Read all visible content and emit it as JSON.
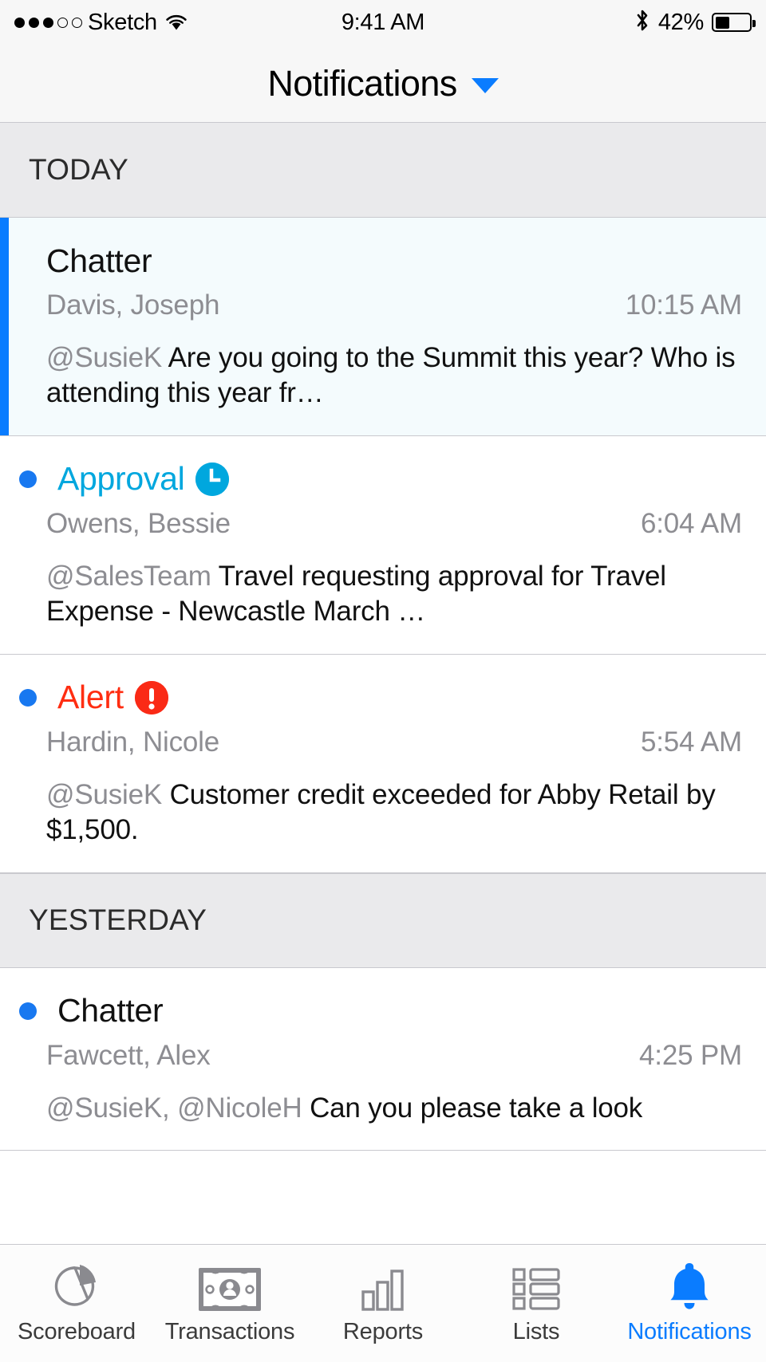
{
  "status_bar": {
    "signal_filled": 3,
    "signal_empty": 2,
    "carrier": "Sketch",
    "wifi_icon": "wifi-icon",
    "time": "9:41 AM",
    "bluetooth_icon": "bluetooth-icon",
    "battery_percent": "42%",
    "battery_level": 42
  },
  "nav": {
    "title": "Notifications",
    "caret_icon": "chevron-down-icon",
    "accent_color": "#0A7CFF"
  },
  "sections": [
    {
      "label": "TODAY",
      "items": [
        {
          "type": "Chatter",
          "type_color": "#111111",
          "highlighted": true,
          "unread": false,
          "badge": null,
          "sender": "Davis, Joseph",
          "time": "10:15 AM",
          "mention": "@SusieK",
          "message": "Are you going to the Summit this year? Who is attending this year fr…"
        },
        {
          "type": "Approval",
          "type_color": "#00A7DE",
          "highlighted": false,
          "unread": true,
          "badge": "clock-badge-icon",
          "badge_color": "#00A7DE",
          "sender": "Owens, Bessie",
          "time": "6:04 AM",
          "mention": "@SalesTeam",
          "message": "Travel requesting approval for Travel Expense - Newcastle March …"
        },
        {
          "type": "Alert",
          "type_color": "#FF2D11",
          "highlighted": false,
          "unread": true,
          "badge": "exclamation-badge-icon",
          "badge_color": "#FA2A16",
          "sender": "Hardin, Nicole",
          "time": "5:54 AM",
          "mention": "@SusieK",
          "message": "Customer credit exceeded for Abby Retail by $1,500."
        }
      ]
    },
    {
      "label": "YESTERDAY",
      "items": [
        {
          "type": "Chatter",
          "type_color": "#111111",
          "highlighted": false,
          "unread": true,
          "badge": null,
          "sender": "Fawcett, Alex",
          "time": "4:25 PM",
          "mention": "@SusieK, @NicoleH",
          "message": "Can you please take a look"
        }
      ]
    }
  ],
  "tabbar": {
    "active": "Notifications",
    "active_color": "#0A7CFF",
    "tabs": [
      {
        "label": "Scoreboard",
        "icon": "pie-chart-icon"
      },
      {
        "label": "Transactions",
        "icon": "banknote-icon"
      },
      {
        "label": "Reports",
        "icon": "bar-chart-icon"
      },
      {
        "label": "Lists",
        "icon": "list-icon"
      },
      {
        "label": "Notifications",
        "icon": "bell-icon"
      }
    ]
  }
}
